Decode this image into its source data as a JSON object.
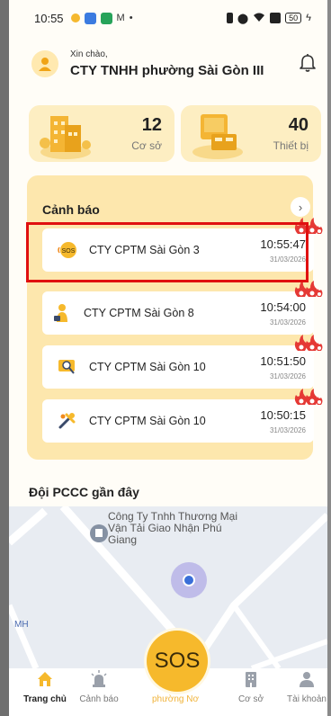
{
  "status_bar": {
    "time": "10:55",
    "battery": "50"
  },
  "header": {
    "greeting": "Xin chào,",
    "company": "CTY TNHH phường Sài Gòn III"
  },
  "stats": [
    {
      "value": "12",
      "label": "Cơ sở"
    },
    {
      "value": "40",
      "label": "Thiết bị"
    }
  ],
  "alerts": {
    "title": "Cảnh báo",
    "more_icon": "chevron-right-icon",
    "items": [
      {
        "name": "CTY CPTM Sài Gòn 3",
        "time": "10:55:47",
        "date": "31/03/2026",
        "icon": "sos-icon"
      },
      {
        "name": "CTY CPTM Sài Gòn 8",
        "time": "10:54:00",
        "date": "31/03/2026",
        "icon": "person-alert-icon"
      },
      {
        "name": "CTY CPTM Sài Gòn 10",
        "time": "10:51:50",
        "date": "31/03/2026",
        "icon": "search-alert-icon"
      },
      {
        "name": "CTY CPTM Sài Gòn 10",
        "time": "10:50:15",
        "date": "31/03/2026",
        "icon": "tools-icon"
      }
    ]
  },
  "nearby": {
    "title": "Đội PCCC gần đây",
    "map_label": "Công Ty Tnhh Thương Mại Vận Tải Giao Nhận Phú Giang",
    "map_edge_label": "MH"
  },
  "bottom_nav": {
    "items": [
      {
        "label": "Trang chủ",
        "icon": "home-icon",
        "active": true
      },
      {
        "label": "Cảnh báo",
        "icon": "siren-icon",
        "active": false
      },
      {
        "label": "Cơ sở",
        "icon": "building-icon",
        "active": false
      },
      {
        "label": "Tài khoản",
        "icon": "user-icon",
        "active": false
      }
    ],
    "sos": {
      "label": "SOS",
      "sub_label": "phường Nơ"
    }
  },
  "colors": {
    "accent": "#f6b92c",
    "panel": "#fde7ad",
    "card": "#fdeec2",
    "highlight": "#e01010",
    "fire": "#e53935"
  }
}
